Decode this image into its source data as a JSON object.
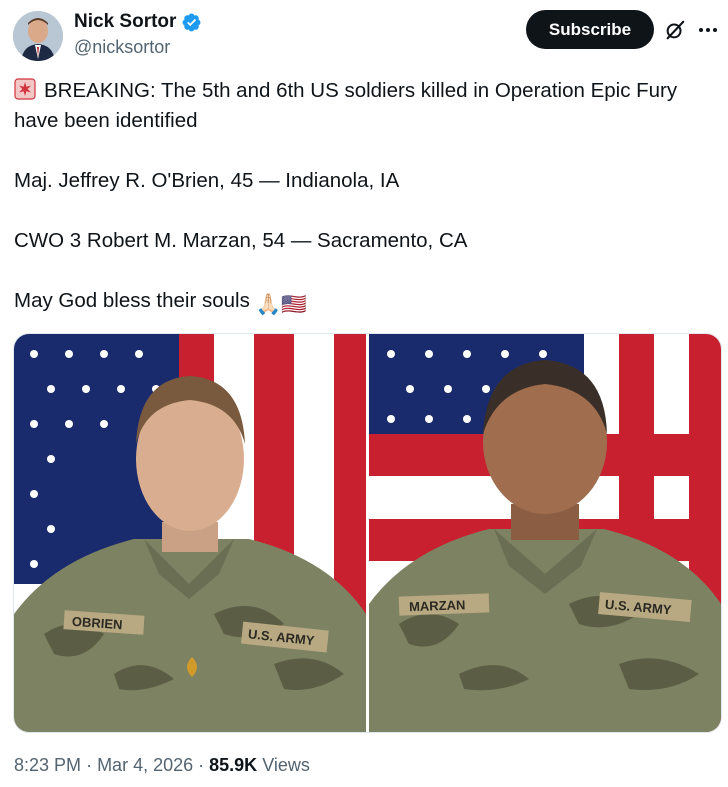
{
  "author": {
    "name": "Nick Sortor",
    "handle": "@nicksortor",
    "verified": true
  },
  "actions": {
    "subscribe_label": "Subscribe",
    "grok_icon": "grok-slash-icon",
    "more_icon": "more-dots-icon"
  },
  "tweet": {
    "line1_prefix_icon": "siren-emoji",
    "line1": "BREAKING: The 5th and 6th US soldiers killed in Operation Epic Fury have been identified",
    "line2": "Maj. Jeffrey R. O'Brien, 45 — Indianola, IA",
    "line3": "CWO 3 Robert M. Marzan, 54 — Sacramento, CA",
    "line4": "May God bless their souls",
    "line4_emojis": "🙏🏻🇺🇸"
  },
  "media": {
    "left": {
      "name_tape": "OBRIEN",
      "branch_tape": "U.S. ARMY"
    },
    "right": {
      "name_tape": "MARZAN",
      "branch_tape": "U.S. ARMY"
    }
  },
  "meta": {
    "time": "8:23 PM",
    "date": "Mar 4, 2026",
    "views_count": "85.9K",
    "views_label": "Views"
  },
  "colors": {
    "subscribe_bg": "#0f1419",
    "verified_blue": "#1d9bf0",
    "secondary_text": "#536471"
  }
}
